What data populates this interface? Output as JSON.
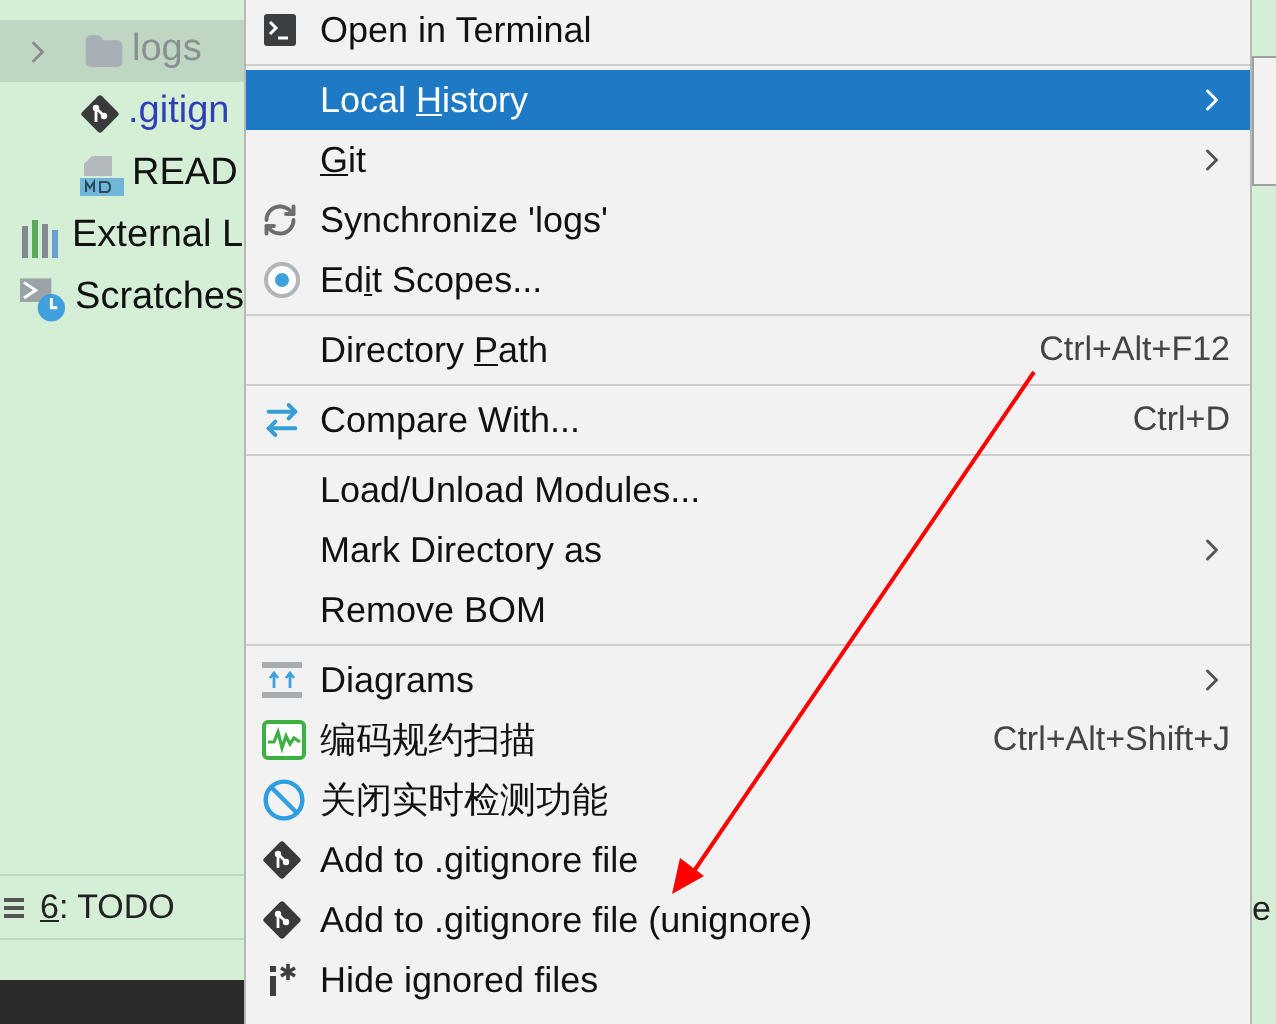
{
  "project_tree": [
    {
      "label": "logs",
      "kind": "folder",
      "selected": true,
      "expandable": true,
      "children": [
        {
          "label": ".gitign",
          "kind": "git",
          "selected": false
        },
        {
          "label": "READ",
          "kind": "markdown",
          "selected": false
        }
      ]
    },
    {
      "label": "External L",
      "kind": "library",
      "selected": false
    },
    {
      "label": "Scratches",
      "kind": "scratch",
      "selected": false
    }
  ],
  "tool_bar": {
    "mnemonic": "6",
    "label": ": TODO"
  },
  "right_edge_text": "e",
  "context_menu": [
    {
      "kind": "terminal",
      "label": "Open in Terminal",
      "selected": false
    },
    {
      "kind": "separator"
    },
    {
      "kind": "plain",
      "label": "Local ",
      "label_key": "H",
      "label_after": "istory",
      "selected": true,
      "submenu": true
    },
    {
      "kind": "plain",
      "label_key": "G",
      "label_after": "it",
      "selected": false,
      "submenu": true
    },
    {
      "kind": "sync",
      "label": "Synchronize 'logs'",
      "selected": false
    },
    {
      "kind": "scope",
      "label": "Ed",
      "label_key": "i",
      "label_after": "t Scopes...",
      "selected": false
    },
    {
      "kind": "separator"
    },
    {
      "kind": "plain",
      "label": "Directory ",
      "label_key": "P",
      "label_after": "ath",
      "shortcut": "Ctrl+Alt+F12",
      "selected": false
    },
    {
      "kind": "separator"
    },
    {
      "kind": "compare",
      "label": "Compare With...",
      "shortcut": "Ctrl+D",
      "selected": false
    },
    {
      "kind": "separator"
    },
    {
      "kind": "plain",
      "label": "Load/Unload Modules...",
      "selected": false
    },
    {
      "kind": "plain",
      "label": "Mark Directory as",
      "selected": false,
      "submenu": true
    },
    {
      "kind": "plain",
      "label": "Remove BOM",
      "selected": false
    },
    {
      "kind": "separator"
    },
    {
      "kind": "diagram",
      "label": "Diagrams",
      "selected": false,
      "submenu": true
    },
    {
      "kind": "scan",
      "label": "编码规约扫描",
      "shortcut": "Ctrl+Alt+Shift+J",
      "selected": false
    },
    {
      "kind": "block",
      "label": "关闭实时检测功能",
      "selected": false
    },
    {
      "kind": "git",
      "label": "Add to .gitignore file",
      "selected": false
    },
    {
      "kind": "git",
      "label": "Add to .gitignore file (unignore)",
      "selected": false
    },
    {
      "kind": "hide",
      "label": "Hide ignored files",
      "selected": false
    }
  ]
}
